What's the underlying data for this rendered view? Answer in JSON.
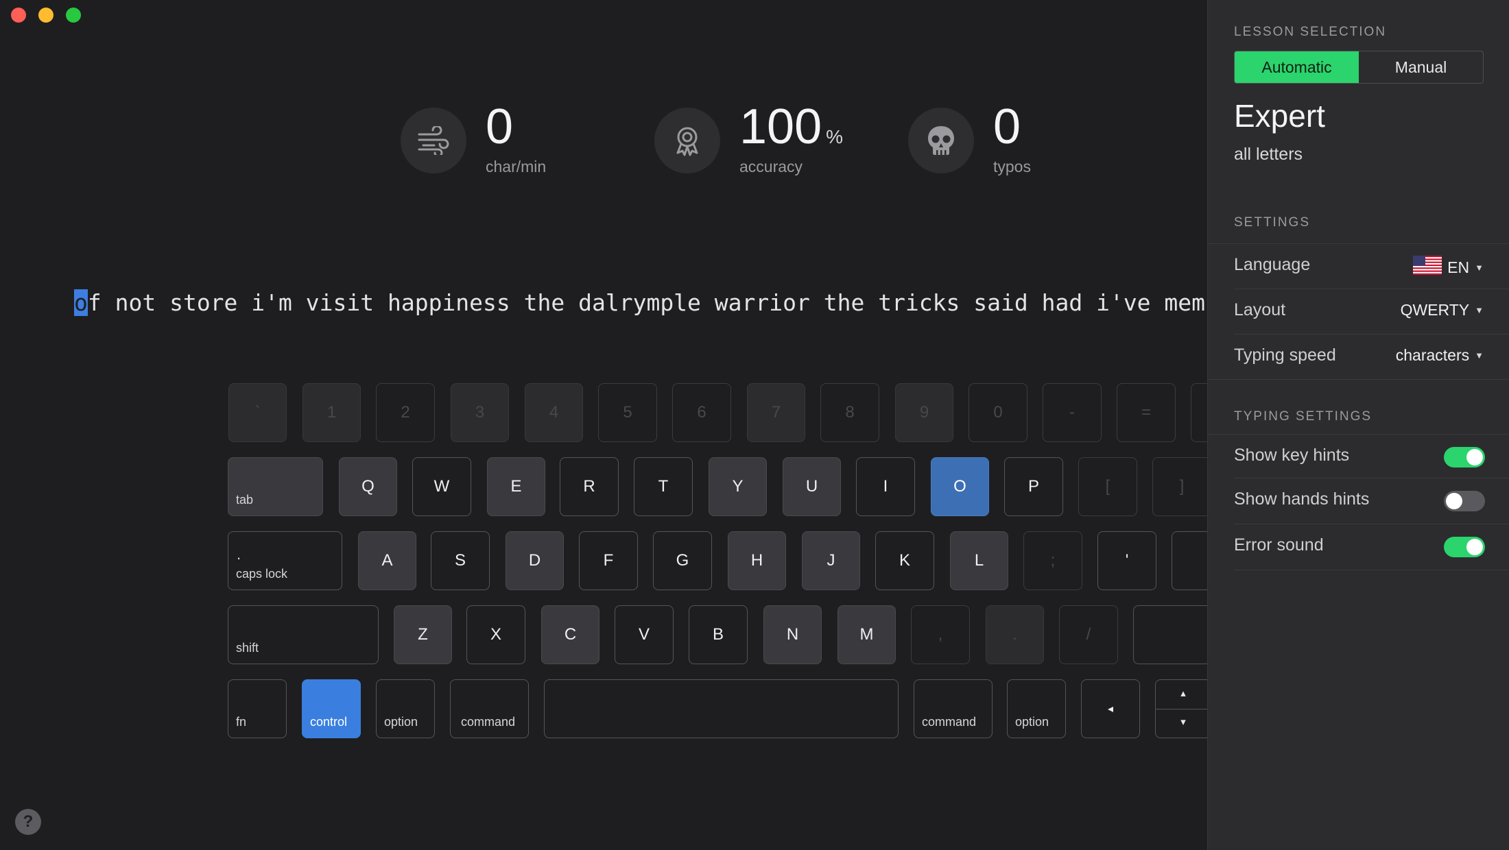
{
  "stats": [
    {
      "value": "0",
      "unit": "",
      "label": "char/min",
      "icon": "wind-icon"
    },
    {
      "value": "100",
      "unit": "%",
      "label": "accuracy",
      "icon": "award-icon"
    },
    {
      "value": "0",
      "unit": "",
      "label": "typos",
      "icon": "skull-icon"
    }
  ],
  "typing": {
    "current_char": "o",
    "rest_text": "f not store i'm visit happiness the dalrymple warrior the tricks said had i've memories"
  },
  "keyboard": {
    "row0": [
      "`",
      "1",
      "2",
      "3",
      "4",
      "5",
      "6",
      "7",
      "8",
      "9",
      "0",
      "-",
      "="
    ],
    "row1": [
      "tab",
      "Q",
      "W",
      "E",
      "R",
      "T",
      "Y",
      "U",
      "I",
      "O",
      "P",
      "[",
      "]"
    ],
    "row2": [
      "caps lock",
      "A",
      "S",
      "D",
      "F",
      "G",
      "H",
      "J",
      "K",
      "L",
      ";",
      "'"
    ],
    "row2_capslock_dot": ".",
    "row3": [
      "shift",
      "Z",
      "X",
      "C",
      "V",
      "B",
      "N",
      "M",
      ",",
      ".",
      "/"
    ],
    "row4": [
      "fn",
      "control",
      "option",
      "command",
      "",
      "command",
      "option"
    ],
    "arrow_left": "◂",
    "arrow_up": "▴",
    "arrow_down": "▾",
    "highlight_key": "O",
    "highlight_modifier": "control",
    "colors": {
      "highlight": "#3d6fb4",
      "control": "#3a7fe0"
    }
  },
  "panel": {
    "lesson_selection_title": "LESSON SELECTION",
    "mode_automatic": "Automatic",
    "mode_manual": "Manual",
    "mode_selected": "Automatic",
    "level_title": "Expert",
    "level_subtitle": "all letters",
    "settings_title": "SETTINGS",
    "language_label": "Language",
    "language_value": "EN",
    "language_flag_icon": "us-flag-icon",
    "layout_label": "Layout",
    "layout_value": "QWERTY",
    "typing_speed_label": "Typing speed",
    "typing_speed_value": "characters",
    "typing_settings_title": "TYPING SETTINGS",
    "show_key_hints_label": "Show key hints",
    "show_key_hints_on": true,
    "show_hands_hints_label": "Show hands hints",
    "show_hands_hints_on": false,
    "error_sound_label": "Error sound",
    "error_sound_on": true,
    "accent_color": "#2bd46c"
  },
  "help_label": "?"
}
